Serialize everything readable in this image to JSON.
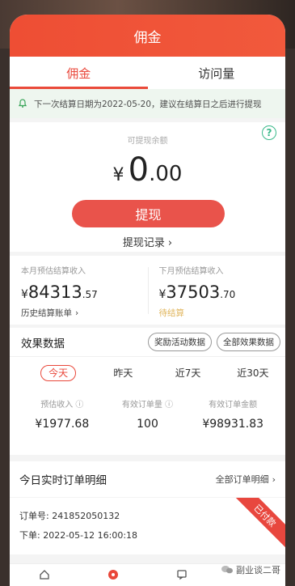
{
  "header": {
    "title": "佣金"
  },
  "tabs": [
    {
      "label": "佣金"
    },
    {
      "label": "访问量"
    }
  ],
  "notice": {
    "text": "下一次结算日期为2022-05-20，建议在结算日之后进行提现"
  },
  "balance": {
    "label": "可提现余额",
    "currency": "¥",
    "integer": "0",
    "decimal": ".00",
    "withdraw_button": "提现",
    "withdraw_record": "提现记录"
  },
  "settlement": {
    "this_month": {
      "label": "本月预估结算收入",
      "currency": "¥",
      "integer": "84313",
      "decimal": ".57",
      "link": "历史结算账单"
    },
    "next_month": {
      "label": "下月预估结算收入",
      "currency": "¥",
      "integer": "37503",
      "decimal": ".70",
      "status": "待结算"
    }
  },
  "effect": {
    "title": "效果数据",
    "buttons": [
      "奖励活动数据",
      "全部效果数据"
    ],
    "periods": [
      "今天",
      "昨天",
      "近7天",
      "近30天"
    ],
    "stats": [
      {
        "label": "预估收入",
        "value": "¥1977.68"
      },
      {
        "label": "有效订单量",
        "value": "100"
      },
      {
        "label": "有效订单金额",
        "value": "¥98931.83"
      }
    ]
  },
  "orders": {
    "title": "今日实时订单明细",
    "all_link": "全部订单明细",
    "item": {
      "order_no_label": "订单号:",
      "order_no": "241852050132",
      "order_time_label": "下单:",
      "order_time": "2022-05-12 16:00:18",
      "status": "已付款"
    }
  },
  "watermark": {
    "text": "副业谈二哥"
  },
  "colors": {
    "brand_red": "#ea4a3a",
    "notice_bg": "#eef6ef",
    "pending_gold": "#e0b45a"
  }
}
